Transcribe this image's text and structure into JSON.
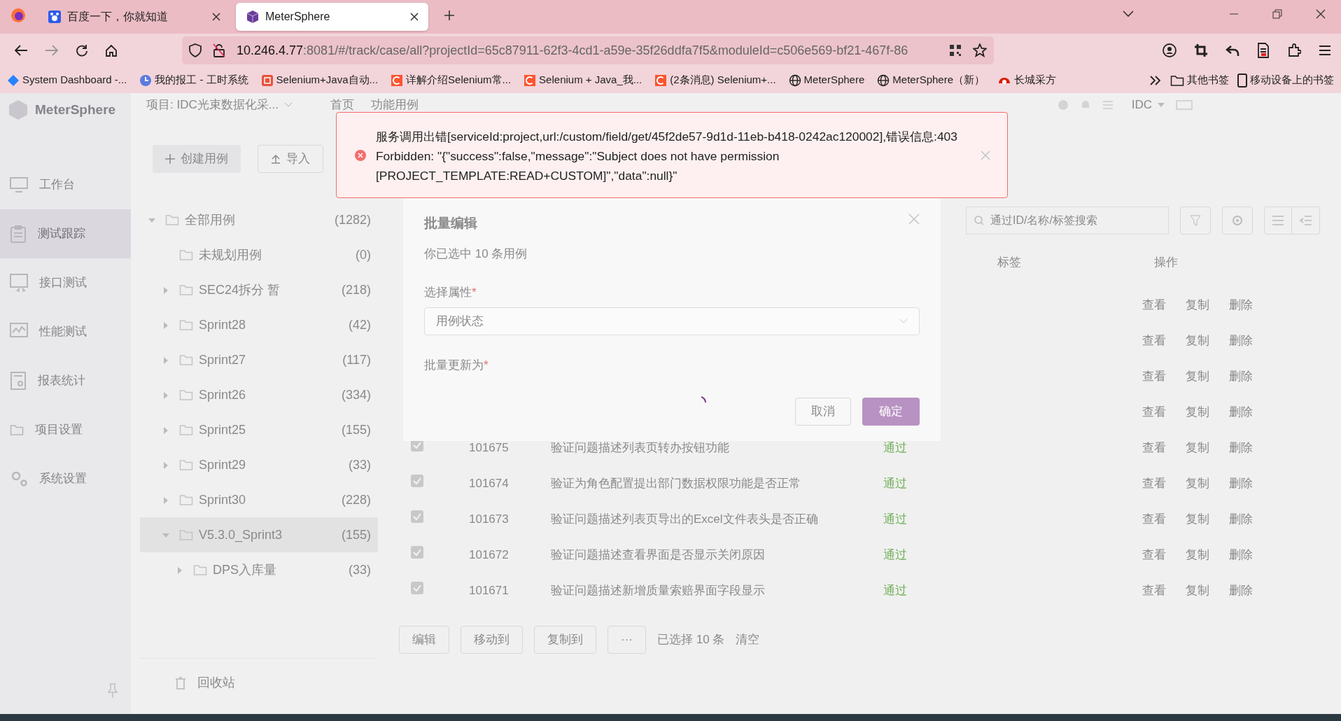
{
  "browser": {
    "tabs": [
      {
        "title": "百度一下，你就知道",
        "selected": false
      },
      {
        "title": "MeterSphere",
        "selected": true
      }
    ],
    "url_host": "10.246.4.77",
    "url_rest": ":8081/#/track/case/all?projectId=65c87911-62f3-4cd1-a59e-35f26ddfa7f5&moduleId=c506e569-bf21-467f-86",
    "bookmarks": [
      "System Dashboard -...",
      "我的报工 - 工时系统",
      "Selenium+Java自动...",
      "详解介绍Selenium常...",
      "Selenium + Java_我...",
      "(2条消息) Selenium+...",
      "MeterSphere",
      "MeterSphere（新）",
      "长城采方"
    ],
    "bookmark_folders": [
      "其他书签",
      "移动设备上的书签"
    ]
  },
  "sidebar": {
    "logo": "MeterSphere",
    "items": [
      {
        "label": "工作台",
        "selected": false
      },
      {
        "label": "测试跟踪",
        "selected": true
      },
      {
        "label": "接口测试",
        "selected": false
      },
      {
        "label": "性能测试",
        "selected": false
      },
      {
        "label": "报表统计",
        "selected": false
      },
      {
        "label": "项目设置",
        "selected": false
      },
      {
        "label": "系统设置",
        "selected": false
      }
    ]
  },
  "header": {
    "project": "项目: IDC光束数据化采...",
    "nav": [
      "首页",
      "功能用例"
    ],
    "workspace": "IDC"
  },
  "toolbar": {
    "create": "创建用例",
    "import": "导入"
  },
  "tree": [
    {
      "label": "全部用例",
      "count": "(1282)",
      "expanded": true,
      "selected": false,
      "children": [
        {
          "label": "未规划用例",
          "count": "(0)",
          "selected": false
        },
        {
          "label": "SEC24拆分 暂",
          "count": "(218)",
          "expanded": false,
          "selected": false
        },
        {
          "label": "Sprint28",
          "count": "(42)",
          "expanded": false,
          "selected": false
        },
        {
          "label": "Sprint27",
          "count": "(117)",
          "expanded": false,
          "selected": false
        },
        {
          "label": "Sprint26",
          "count": "(334)",
          "expanded": false,
          "selected": false
        },
        {
          "label": "Sprint25",
          "count": "(155)",
          "expanded": false,
          "selected": false
        },
        {
          "label": "Sprint29",
          "count": "(33)",
          "expanded": false,
          "selected": false
        },
        {
          "label": "Sprint30",
          "count": "(228)",
          "expanded": false,
          "selected": false
        },
        {
          "label": "V5.3.0_Sprint3",
          "count": "(155)",
          "expanded": true,
          "selected": true,
          "children": [
            {
              "label": "DPS入库量",
              "count": "(33)",
              "expanded": false,
              "selected": false
            }
          ]
        }
      ]
    }
  ],
  "recycle": "回收站",
  "table": {
    "search": {
      "placeholder": "通过ID/名称/标签搜索"
    },
    "columns": [
      "标签",
      "操作"
    ],
    "rows": [
      {
        "actions": [
          "查看",
          "复制",
          "删除"
        ]
      },
      {
        "actions": [
          "查看",
          "复制",
          "删除"
        ]
      },
      {
        "actions": [
          "查看",
          "复制",
          "删除"
        ]
      },
      {
        "actions": [
          "查看",
          "复制",
          "删除"
        ]
      },
      {
        "checked": true,
        "id": "101675",
        "name": "验证问题描述列表页转办按钮功能",
        "status": "通过",
        "actions": [
          "查看",
          "复制",
          "删除"
        ]
      },
      {
        "checked": true,
        "id": "101674",
        "name": "验证为角色配置提出部门数据权限功能是否正常",
        "status": "通过",
        "actions": [
          "查看",
          "复制",
          "删除"
        ]
      },
      {
        "checked": true,
        "id": "101673",
        "name": "验证问题描述列表页导出的Excel文件表头是否正确",
        "status": "通过",
        "actions": [
          "查看",
          "复制",
          "删除"
        ]
      },
      {
        "checked": true,
        "id": "101672",
        "name": "验证问题描述查看界面是否显示关闭原因",
        "status": "通过",
        "actions": [
          "查看",
          "复制",
          "删除"
        ]
      },
      {
        "checked": true,
        "id": "101671",
        "name": "验证问题描述新增质量索赔界面字段显示",
        "status": "通过",
        "actions": [
          "查看",
          "复制",
          "删除"
        ]
      }
    ]
  },
  "footer": {
    "buttons": [
      "编辑",
      "移动到",
      "复制到",
      "···"
    ],
    "selected_text": "已选择 10 条",
    "clear": "清空"
  },
  "modal": {
    "title": "批量编辑",
    "subtitle": "你已选中 10 条用例",
    "field_label": "选择属性",
    "field_mark": "*",
    "select_value": "用例状态",
    "update_label": "批量更新为",
    "update_mark": "*",
    "loading": true,
    "cancel": "取消",
    "confirm": "确定"
  },
  "error": {
    "message": "服务调用出错[serviceId:project,url:/custom/field/get/45f2de57-9d1d-11eb-b418-0242ac120002],错误信息:403\nForbidden: \"{\"success\":false,\"message\":\"Subject does not have permission\n[PROJECT_TEMPLATE:READ+CUSTOM]\",\"data\":null}\""
  }
}
